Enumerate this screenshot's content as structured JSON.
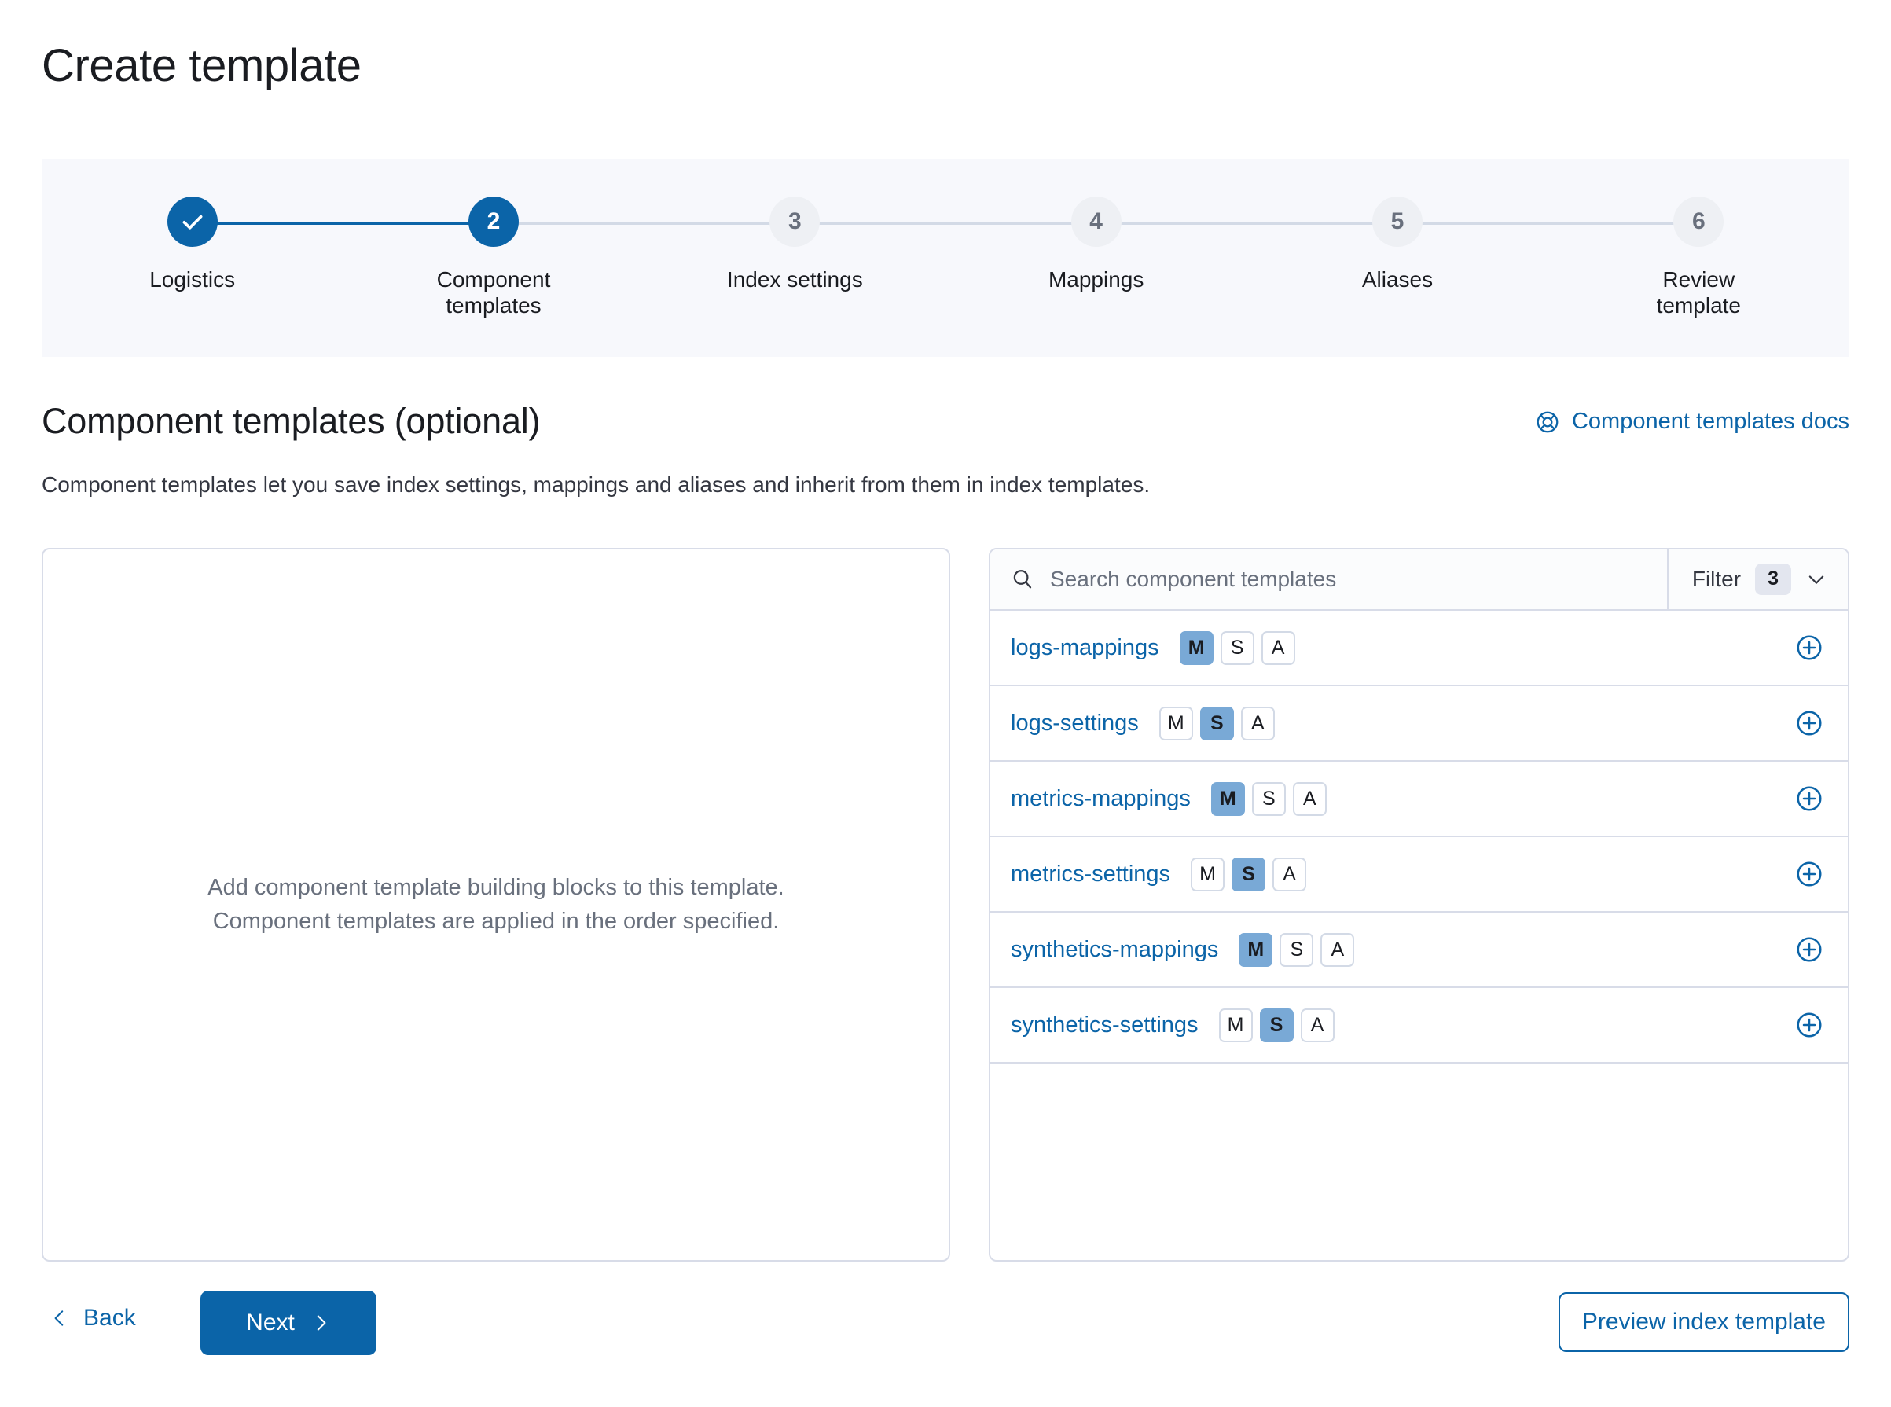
{
  "page": {
    "title": "Create template"
  },
  "steps": [
    {
      "number": "1",
      "label": "Logistics",
      "state": "complete",
      "icon": "check-icon"
    },
    {
      "number": "2",
      "label": "Component templates",
      "state": "current",
      "icon": ""
    },
    {
      "number": "3",
      "label": "Index settings",
      "state": "upcoming",
      "icon": ""
    },
    {
      "number": "4",
      "label": "Mappings",
      "state": "upcoming",
      "icon": ""
    },
    {
      "number": "5",
      "label": "Aliases",
      "state": "upcoming",
      "icon": ""
    },
    {
      "number": "6",
      "label": "Review template",
      "state": "upcoming",
      "icon": ""
    }
  ],
  "section": {
    "title": "Component templates (optional)",
    "description": "Component templates let you save index settings, mappings and aliases and inherit from them in index templates.",
    "docs_link": "Component templates docs",
    "docs_icon": "help-lifebuoy-icon"
  },
  "drop_zone": {
    "empty_line1": "Add component template building blocks to this template.",
    "empty_line2": "Component templates are applied in the order specified."
  },
  "search": {
    "placeholder": "Search component templates",
    "value": "",
    "icon": "search-icon",
    "filter_label": "Filter",
    "filter_count": "3",
    "filter_icon": "chevron-down-icon"
  },
  "templates": [
    {
      "name": "logs-mappings",
      "badges": [
        {
          "label": "M",
          "active": true
        },
        {
          "label": "S",
          "active": false
        },
        {
          "label": "A",
          "active": false
        }
      ],
      "add_icon": "plus-in-circle-icon"
    },
    {
      "name": "logs-settings",
      "badges": [
        {
          "label": "M",
          "active": false
        },
        {
          "label": "S",
          "active": true
        },
        {
          "label": "A",
          "active": false
        }
      ],
      "add_icon": "plus-in-circle-icon"
    },
    {
      "name": "metrics-mappings",
      "badges": [
        {
          "label": "M",
          "active": true
        },
        {
          "label": "S",
          "active": false
        },
        {
          "label": "A",
          "active": false
        }
      ],
      "add_icon": "plus-in-circle-icon"
    },
    {
      "name": "metrics-settings",
      "badges": [
        {
          "label": "M",
          "active": false
        },
        {
          "label": "S",
          "active": true
        },
        {
          "label": "A",
          "active": false
        }
      ],
      "add_icon": "plus-in-circle-icon"
    },
    {
      "name": "synthetics-mappings",
      "badges": [
        {
          "label": "M",
          "active": true
        },
        {
          "label": "S",
          "active": false
        },
        {
          "label": "A",
          "active": false
        }
      ],
      "add_icon": "plus-in-circle-icon"
    },
    {
      "name": "synthetics-settings",
      "badges": [
        {
          "label": "M",
          "active": false
        },
        {
          "label": "S",
          "active": true
        },
        {
          "label": "A",
          "active": false
        }
      ],
      "add_icon": "plus-in-circle-icon"
    }
  ],
  "footer": {
    "back_label": "Back",
    "back_icon": "chevron-left-icon",
    "next_label": "Next",
    "next_icon": "chevron-right-icon",
    "preview_label": "Preview index template"
  },
  "colors": {
    "accent": "#0b64a8",
    "badge_active": "#79a9d6",
    "border": "#d8dce8",
    "step_bar_bg": "#f7f8fc",
    "muted_text": "#69707d"
  }
}
